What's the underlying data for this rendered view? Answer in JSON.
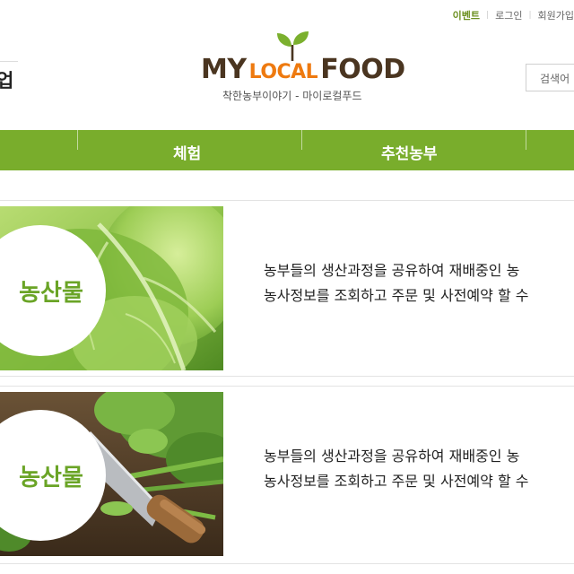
{
  "header": {
    "util_links": {
      "event": "이벤트",
      "login": "로그인",
      "signup": "회원가입"
    },
    "left_heading": "업",
    "logo": {
      "my": "MY",
      "local": "LOCAL",
      "food": "FOOD",
      "tagline": "착한농부이야기 - 마이로컬푸드"
    },
    "search": {
      "placeholder": "검색어"
    }
  },
  "nav": {
    "items": [
      {
        "label": "체험"
      },
      {
        "label": "추천농부"
      }
    ]
  },
  "products": [
    {
      "badge": "농산물",
      "desc_line1": "농부들의 생산과정을 공유하여 재배중인 농",
      "desc_line2": "농사정보를 조회하고 주문 및 사전예약 할 수"
    },
    {
      "badge": "농산물",
      "desc_line1": "농부들의 생산과정을 공유하여 재배중인 농",
      "desc_line2": "농사정보를 조회하고 주문 및 사전예약 할 수"
    }
  ],
  "colors": {
    "nav_green": "#79ad2c",
    "badge_green": "#6aa426",
    "logo_brown": "#4a3520",
    "logo_orange": "#ee7a10"
  }
}
